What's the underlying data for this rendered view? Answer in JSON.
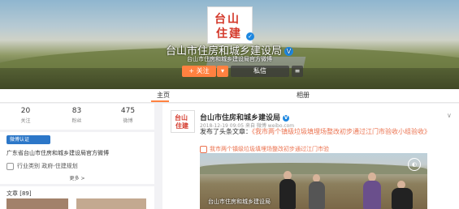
{
  "cover": {
    "logo_line1": "台山",
    "logo_line2": "住建",
    "page_name": "台山市住房和城乡建设局",
    "description": "台山市住房和城乡建设局官方微博",
    "follow_label": "+ 关注",
    "message_label": "私信"
  },
  "tabs": {
    "home": "主页",
    "album": "相册"
  },
  "stats": [
    {
      "num": "20",
      "label": "关注"
    },
    {
      "num": "83",
      "label": "粉丝"
    },
    {
      "num": "475",
      "label": "微博"
    }
  ],
  "info": {
    "tag": "微博认证",
    "bio": "广东省台山市住房和城乡建设局官方微博",
    "category": "行业类别 政府-住建规划",
    "more": "更多 >"
  },
  "articles": {
    "heading": "文章 [89]"
  },
  "post": {
    "avatar_line1": "台山",
    "avatar_line2": "住建",
    "name": "台山市住房和城乡建设局",
    "meta": "2018-12-19 09:05 来自 微博 weibo.com",
    "text_prefix": "发布了头条文章：",
    "text_link": "《我市两个镇级垃圾填埋场整改初步通过江门市验收小组验收》",
    "link_text": "我市两个镇级垃圾填埋场整改初步通过江门市验",
    "video_watermark": "台山市住房和城乡建设局"
  }
}
